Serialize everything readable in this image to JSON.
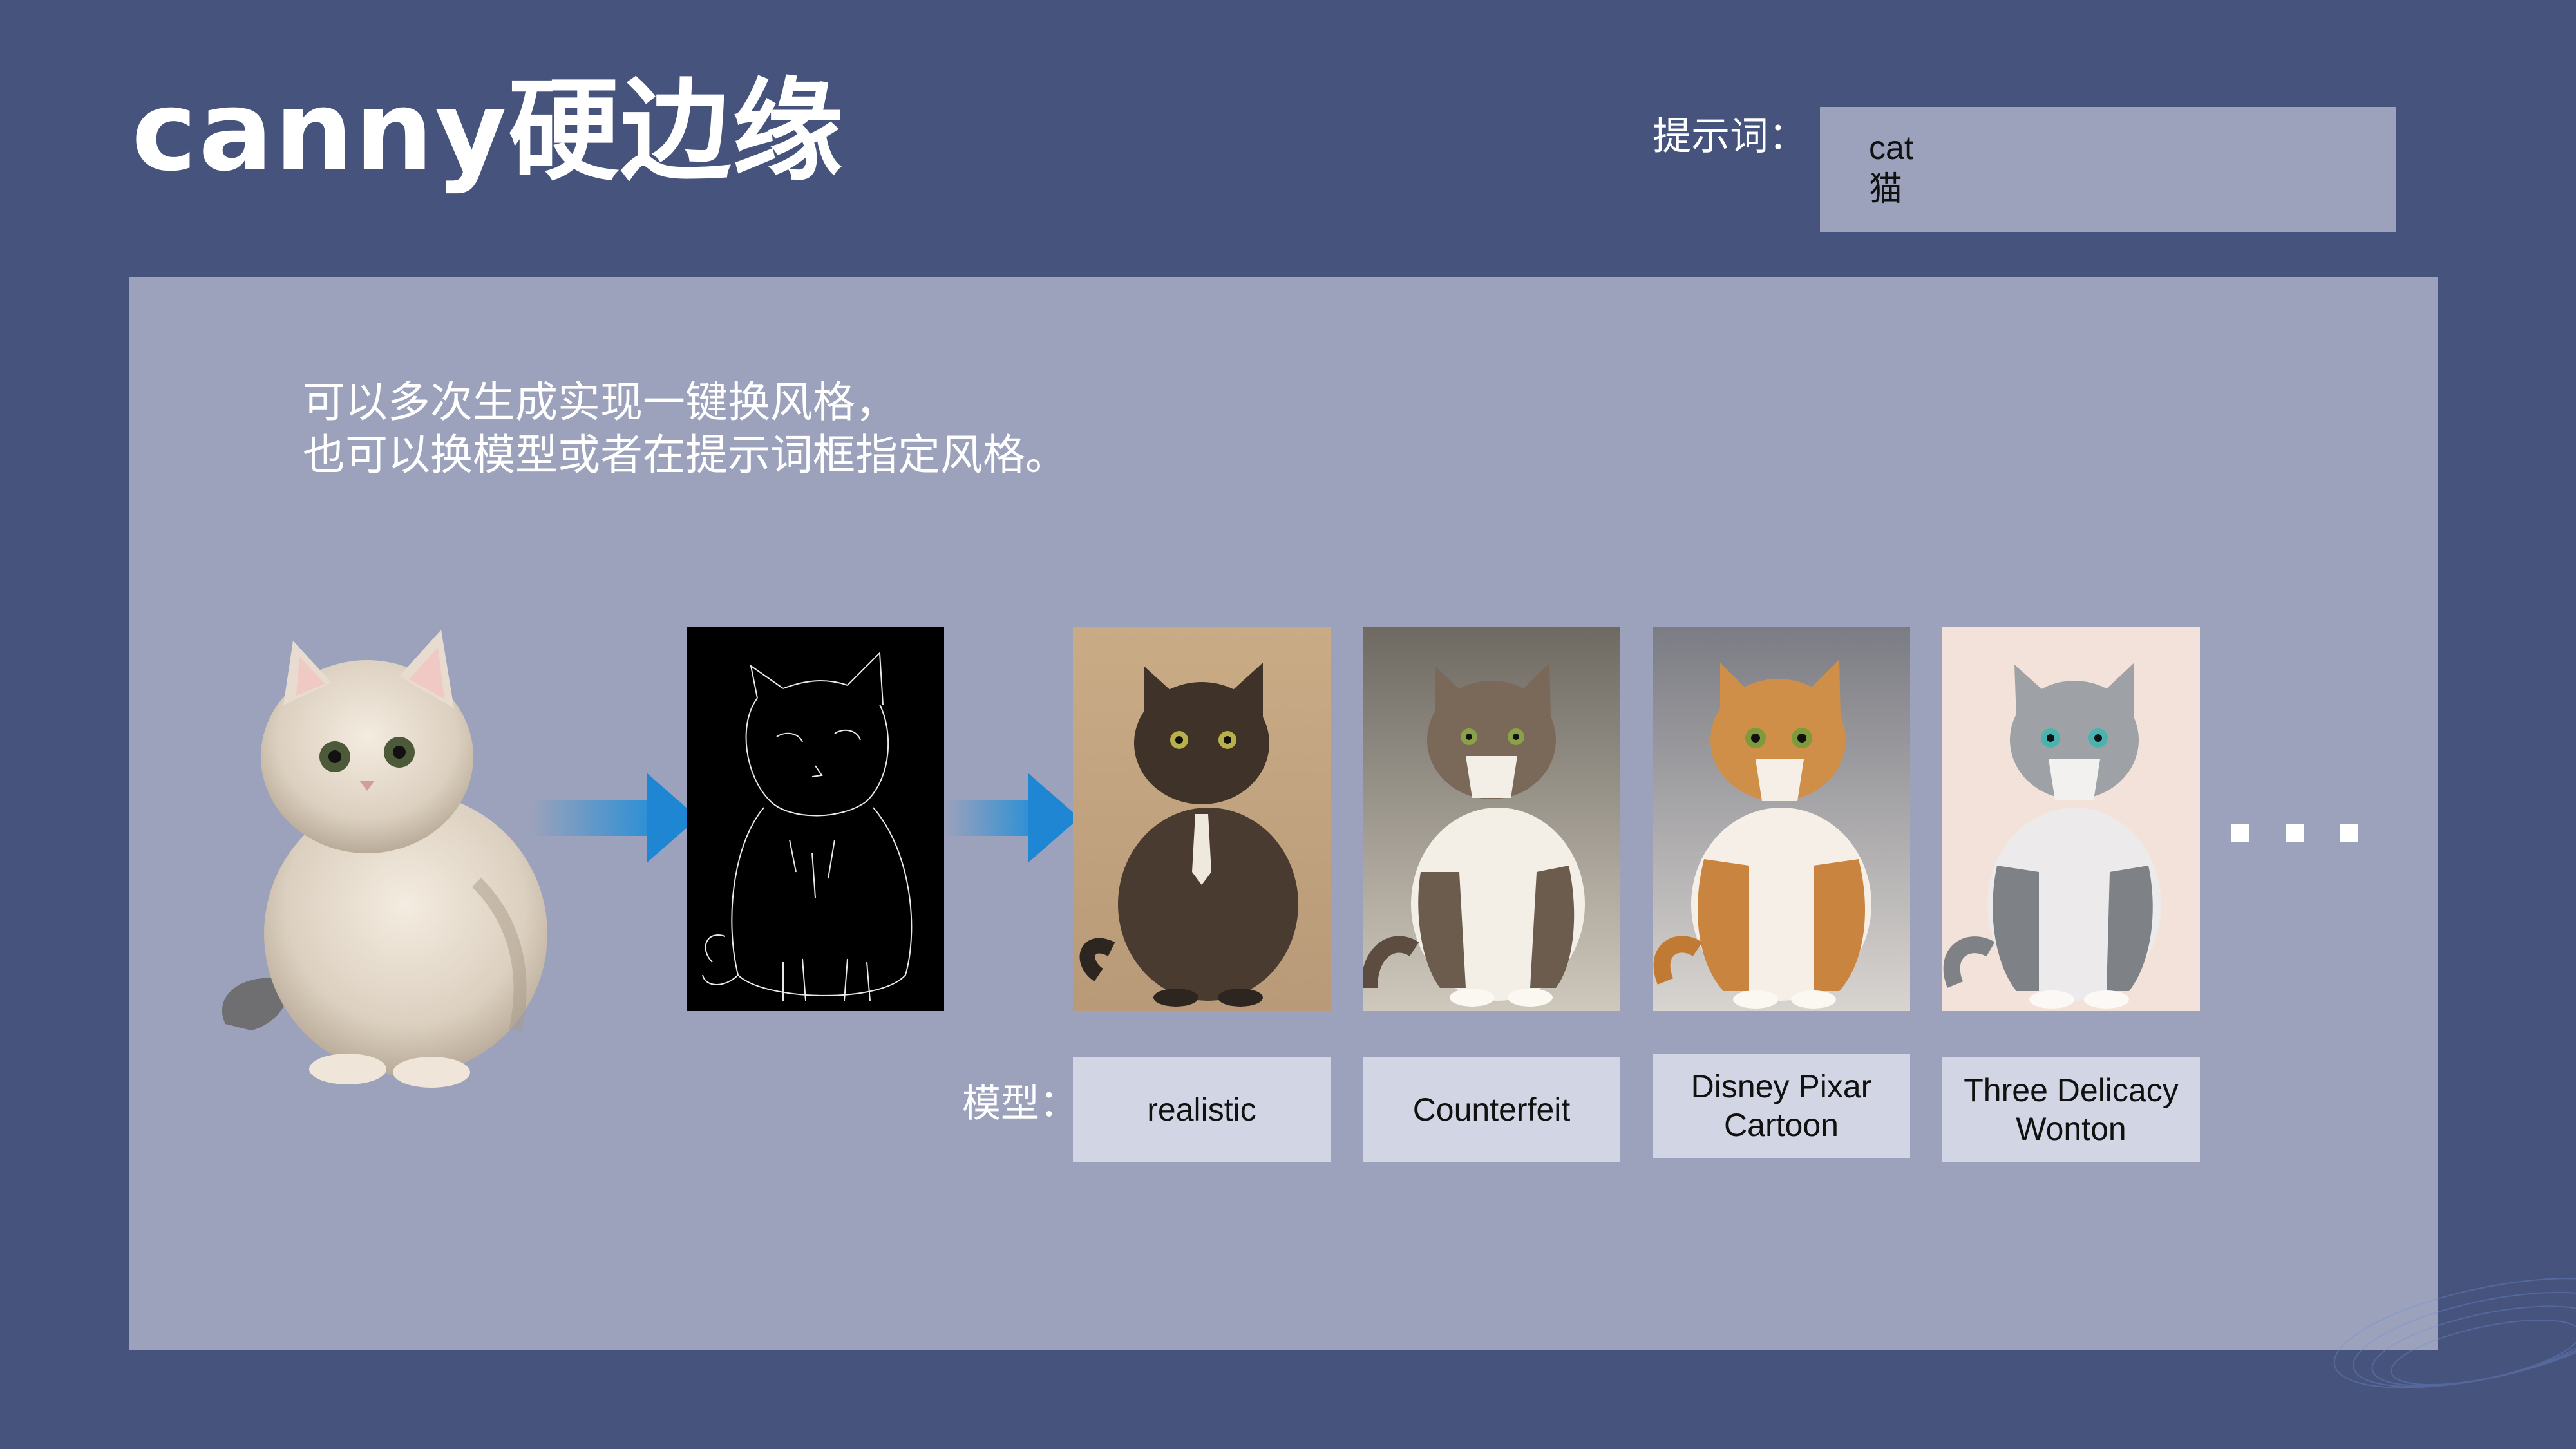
{
  "header": {
    "title": "canny硬边缘",
    "prompt_label": "提示词：",
    "prompt_lines": [
      "cat",
      "猫"
    ]
  },
  "description": {
    "line1": "可以多次生成实现一键换风格，",
    "line2": "也可以换模型或者在提示词框指定风格。"
  },
  "images": {
    "source": "cat-photo",
    "edge_map": "canny-edge-map",
    "outputs": [
      "cat-realistic",
      "cat-counterfeit",
      "cat-disney-pixar-cartoon",
      "cat-three-delicacy-wonton"
    ]
  },
  "models": {
    "label": "模型：",
    "items": [
      {
        "line1": "realistic",
        "line2": ""
      },
      {
        "line1": "Counterfeit",
        "line2": ""
      },
      {
        "line1": "Disney Pixar",
        "line2": "Cartoon"
      },
      {
        "line1": "Three Delicacy",
        "line2": "Wonton"
      }
    ]
  },
  "colors": {
    "background": "#46537d",
    "panel": "#9ca2bb",
    "model_box": "#d2d5e3",
    "arrow": "#2a8fd6"
  },
  "icons": {
    "arrow": "right-arrow-icon",
    "more": "ellipsis-icon"
  }
}
